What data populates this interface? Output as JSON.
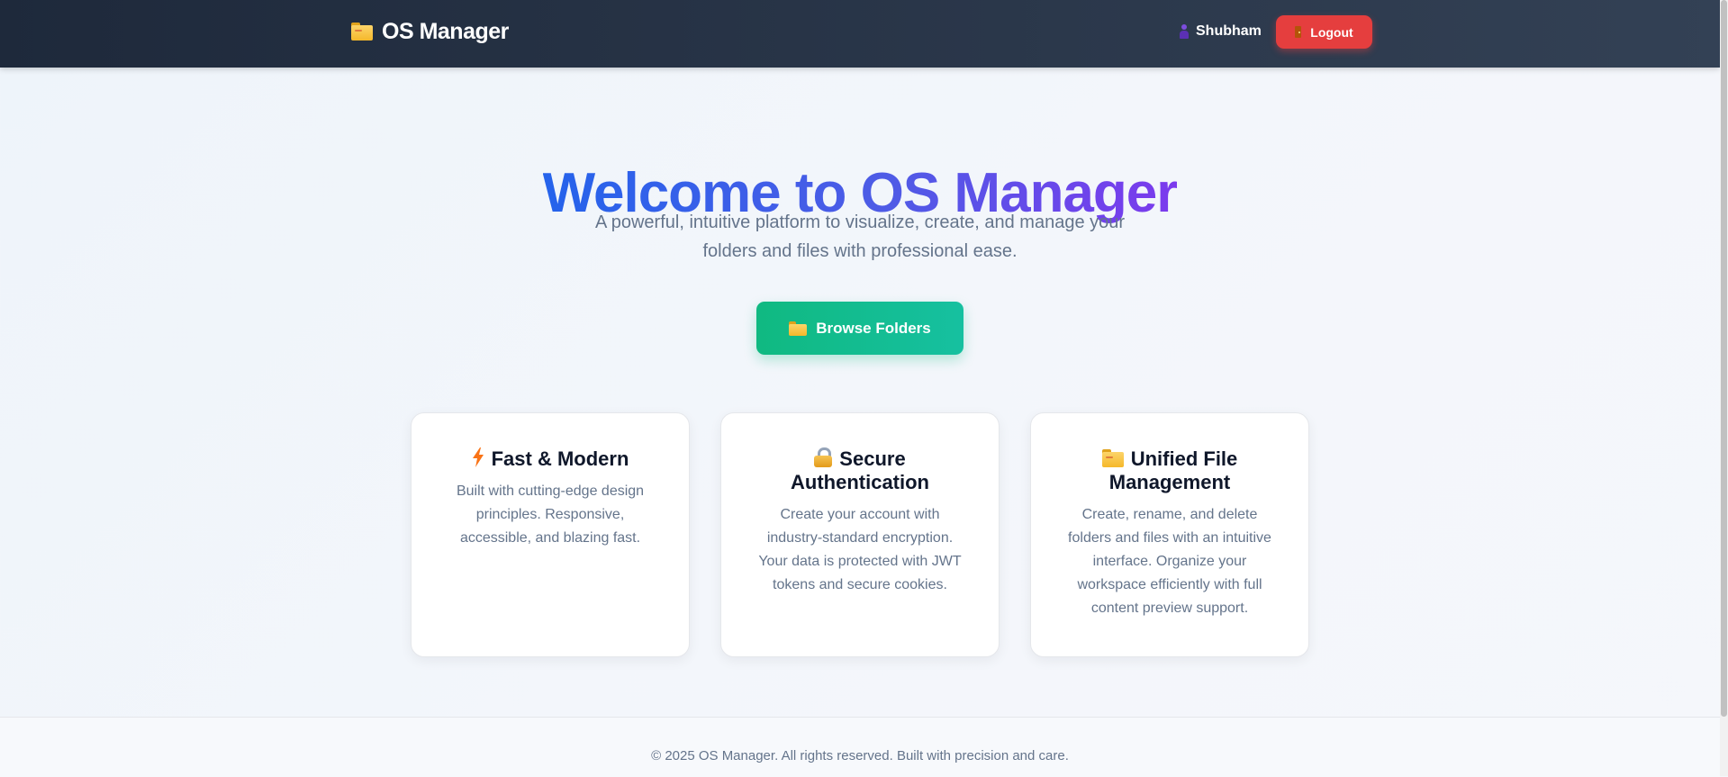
{
  "navbar": {
    "brand": "OS Manager",
    "brand_icon": "folder-icon",
    "username": "Shubham",
    "user_icon": "user-icon",
    "logout_label": "Logout",
    "logout_icon": "door-icon"
  },
  "hero": {
    "title": "Welcome to OS Manager",
    "subtitle": "A powerful, intuitive platform to visualize, create, and manage your folders and files with professional ease.",
    "cta_label": "Browse Folders",
    "cta_icon": "folder-icon"
  },
  "features": [
    {
      "icon": "lightning-icon",
      "title": "Fast & Modern",
      "description": "Built with cutting-edge design principles. Responsive, accessible, and blazing fast."
    },
    {
      "icon": "lock-icon",
      "title": "Secure Authentication",
      "description": "Create your account with industry-standard encryption. Your data is protected with JWT tokens and secure cookies."
    },
    {
      "icon": "folder-icon",
      "title": "Unified File Management",
      "description": "Create, rename, and delete folders and files with an intuitive interface. Organize your workspace efficiently with full content preview support."
    }
  ],
  "footer": {
    "text": "© 2025 OS Manager. All rights reserved. Built with precision and care."
  },
  "colors": {
    "navbar": "#1e293b",
    "logout": "#e53e3e",
    "cta": "#10b981",
    "title_gradient_start": "#2563eb",
    "title_gradient_end": "#7c3aed"
  }
}
